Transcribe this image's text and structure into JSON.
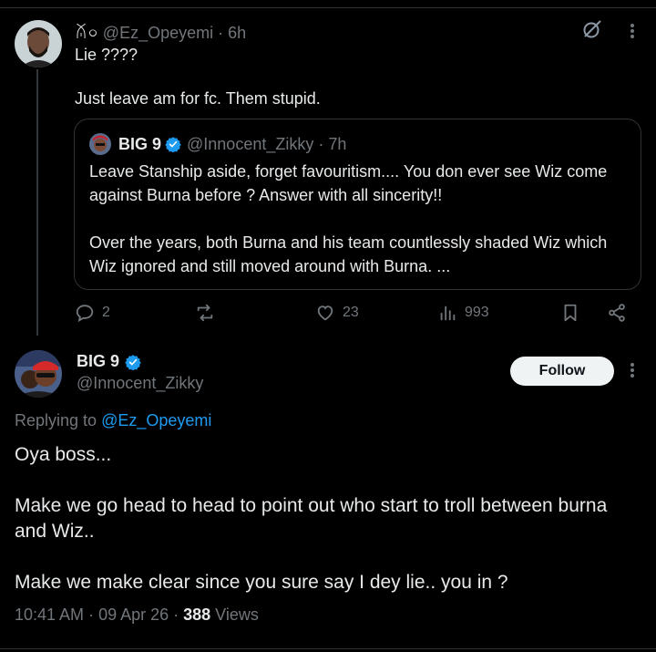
{
  "reply_tweet": {
    "name": "ꊼ০",
    "handle": "@Ez_Opeyemi",
    "separator": " · ",
    "time": "6h",
    "lines": [
      "Lie ????",
      "Just leave am for fc. Them stupid."
    ],
    "quote": {
      "name": "BIG 9",
      "handle": "@Innocent_Zikky · 7h",
      "paragraph_1": "Leave Stanship aside, forget favouritism.... You don ever see Wiz come against Burna before ? Answer with all sincerity!!",
      "paragraph_2": "Over the years, both Burna and his team countlessly shaded Wiz which Wiz ignored and still moved around with Burna. ..."
    },
    "actions": {
      "replies": "2",
      "reposts": "",
      "likes": "23",
      "views": "993"
    }
  },
  "main_tweet": {
    "name": "BIG 9",
    "handle": "@Innocent_Zikky",
    "follow_label": "Follow",
    "replying_prefix": "Replying to ",
    "replying_to": "@Ez_Opeyemi",
    "paragraphs": [
      "Oya boss...",
      "Make we go head to head to point out who start to troll between burna and Wiz..",
      "Make we make clear since you sure say I dey lie.. you in ?"
    ],
    "time": "10:41 AM",
    "date_separator": " · ",
    "date": "09 Apr 26",
    "views_separator": " · ",
    "views_count": "388",
    "views_label": " Views"
  },
  "colors": {
    "background": "#000000",
    "text": "#e7e9ea",
    "secondary": "#71767b",
    "accent": "#1d9bf0",
    "border": "#2f3336"
  },
  "icons": [
    "grok-icon",
    "more-icon",
    "verified-icon",
    "reply-icon",
    "repost-icon",
    "like-icon",
    "views-icon",
    "bookmark-icon",
    "share-icon"
  ]
}
